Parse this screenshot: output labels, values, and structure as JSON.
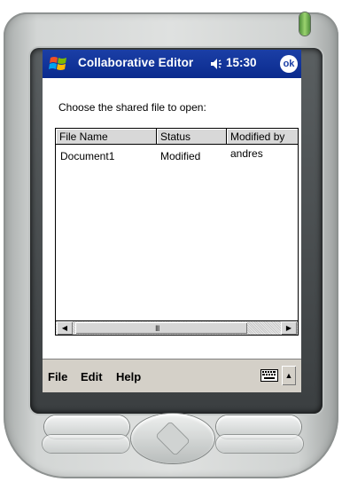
{
  "titlebar": {
    "start_icon": "windows-flag-icon",
    "title": "Collaborative Editor",
    "volume_icon": "speaker-icon",
    "time": "15:30",
    "ok_label": "ok"
  },
  "main": {
    "prompt": "Choose the shared file to open:",
    "columns": [
      "File Name",
      "Status",
      "Modified by"
    ],
    "rows": [
      {
        "name": "Document1",
        "status": "Modified",
        "modified_by": "andres"
      }
    ],
    "scroll_grip": "III"
  },
  "menubar": {
    "items": [
      "File",
      "Edit",
      "Help"
    ],
    "keyboard_icon": "keyboard-icon",
    "sip_arrow_icon": "triangle-up-icon"
  },
  "colors": {
    "titlebar": "#0a2a8d",
    "menubar": "#d4d0c8"
  }
}
